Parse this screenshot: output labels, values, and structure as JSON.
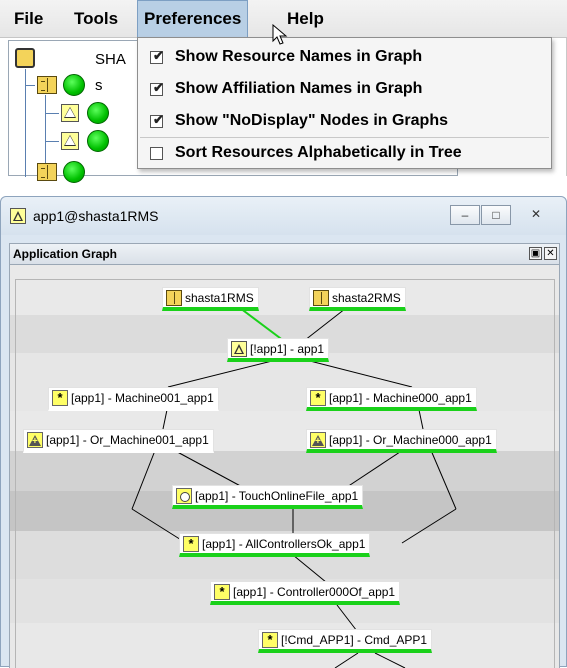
{
  "menubar": {
    "file": "File",
    "tools": "Tools",
    "preferences": "Preferences",
    "help": "Help"
  },
  "tree": {
    "root_label": "SHA",
    "child_label": "s"
  },
  "preferences_menu": {
    "items": [
      {
        "label": "Show Resource Names in Graph",
        "checked": true
      },
      {
        "label": "Show Affiliation Names in Graph",
        "checked": true
      },
      {
        "label": "Show \"NoDisplay\" Nodes in Graphs",
        "checked": true
      },
      {
        "label": "Sort Resources Alphabetically in Tree",
        "checked": false
      }
    ],
    "check_mark": "☑"
  },
  "graph_window": {
    "title": "app1@shasta1RMS",
    "minimize_icon": "–",
    "maximize_icon": "□",
    "close_icon": "✕",
    "panel_title": "Application Graph",
    "panel_restore_icon": "▣",
    "panel_close_icon": "✕"
  },
  "graph": {
    "nodes": [
      {
        "id": "shasta1RMS",
        "label": "shasta1RMS",
        "icon": "book-icon"
      },
      {
        "id": "shasta2RMS",
        "label": "shasta2RMS",
        "icon": "book-icon"
      },
      {
        "id": "app1",
        "label": "[!app1]  -  app1",
        "icon": "application-triangle-icon"
      },
      {
        "id": "m001",
        "label": "[app1]  -  Machine001_app1",
        "icon": "asterisk-icon"
      },
      {
        "id": "m000",
        "label": "[app1]  -  Machine000_app1",
        "icon": "asterisk-icon"
      },
      {
        "id": "or001",
        "label": "[app1]  -  Or_Machine001_app1",
        "icon": "or-icon"
      },
      {
        "id": "or000",
        "label": "[app1]  -  Or_Machine000_app1",
        "icon": "or-icon"
      },
      {
        "id": "touch",
        "label": "[app1]  -  TouchOnlineFile_app1",
        "icon": "circle-icon"
      },
      {
        "id": "allok",
        "label": "[app1]  -  AllControllersOk_app1",
        "icon": "asterisk-icon"
      },
      {
        "id": "ctrl",
        "label": "[app1]  -  Controller000Of_app1",
        "icon": "asterisk-icon"
      },
      {
        "id": "cmd",
        "label": "[!Cmd_APP1]  -  Cmd_APP1",
        "icon": "asterisk-icon"
      }
    ],
    "status_color": "#1ad11a",
    "edge_color": "#000000",
    "highlight_edge_color": "#1ad11a"
  }
}
